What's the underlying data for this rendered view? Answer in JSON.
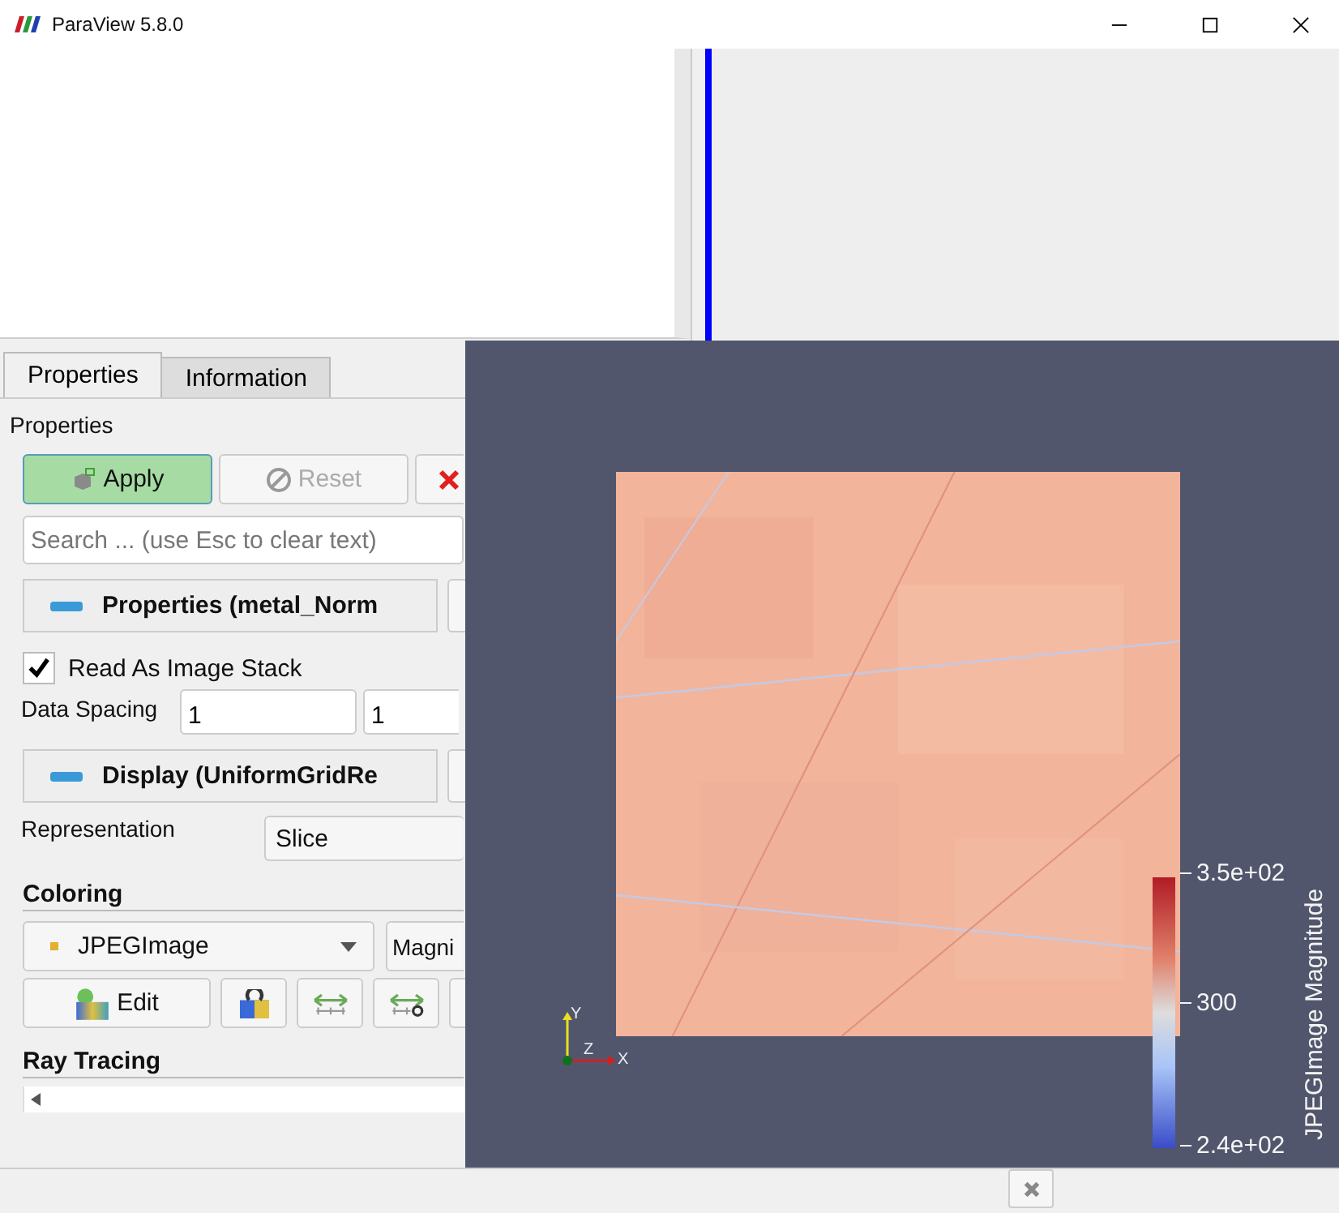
{
  "window": {
    "title": "ParaView 5.8.0"
  },
  "tabs": [
    {
      "label": "Properties",
      "selected": true
    },
    {
      "label": "Information",
      "selected": false
    }
  ],
  "panel_title": "Properties",
  "actions": [
    {
      "kind": "apply",
      "label": "Apply",
      "disabled": false
    },
    {
      "kind": "reset",
      "label": "Reset",
      "disabled": true
    },
    {
      "kind": "delete",
      "disabled": false
    }
  ],
  "search": {
    "placeholder": "Search ... (use Esc to clear text)"
  },
  "properties_section": {
    "title": "Properties (metal_Norm",
    "read_as_image_stack": {
      "label": "Read As Image Stack",
      "checked": true
    },
    "data_spacing": {
      "label": "Data Spacing",
      "values": [
        "1",
        "1"
      ]
    }
  },
  "display_section": {
    "title": "Display (UniformGridRe",
    "representation": {
      "label": "Representation",
      "value": "Slice"
    }
  },
  "coloring": {
    "title": "Coloring",
    "array": "JPEGImage",
    "component": "Magni",
    "buttons": [
      {
        "kind": "edit",
        "label": "Edit"
      },
      {
        "kind": "preset"
      },
      {
        "kind": "rescale"
      },
      {
        "kind": "rescale_custom"
      }
    ]
  },
  "ray_tracing": {
    "title": "Ray Tracing"
  },
  "render_view": {
    "color_legend": {
      "title": "JPEGImage Magnitude",
      "ticks": [
        "3.5e+02",
        "300",
        "2.4e+02"
      ]
    },
    "axes": [
      "Y",
      "Z",
      "X"
    ]
  }
}
